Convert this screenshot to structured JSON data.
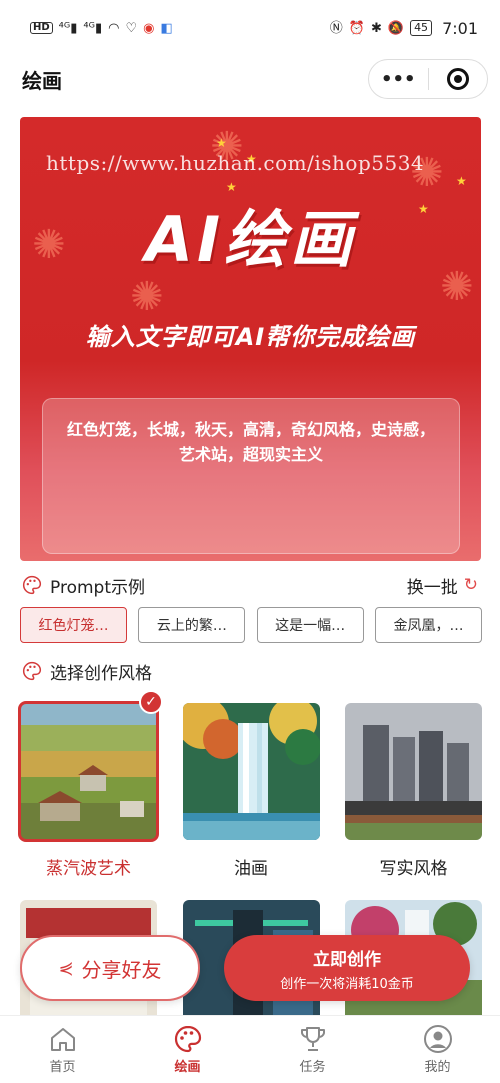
{
  "status_bar": {
    "left_icons": [
      "HD",
      "4G",
      "4G",
      "wifi",
      "heart",
      "weibo",
      "app"
    ],
    "battery": "45",
    "time": "7:01"
  },
  "nav": {
    "title": "绘画",
    "more_icon": "more-dots-icon",
    "close_icon": "target-icon"
  },
  "banner": {
    "watermark": "https://www.huzhan.com/ishop5534",
    "title": "AI绘画",
    "subtitle": "输入文字即可AI帮你完成绘画",
    "prompt_text": "红色灯笼，长城，秋天，高清，奇幻风格，史诗感，艺术站，超现实主义"
  },
  "prompt_section": {
    "title": "Prompt示例",
    "refresh_label": "换一批",
    "chips": [
      "红色灯笼…",
      "云上的繁…",
      "这是一幅…",
      "金凤凰，…"
    ],
    "active_chip": 0
  },
  "style_section": {
    "title": "选择创作风格",
    "styles": [
      {
        "label": "蒸汽波艺术",
        "selected": true
      },
      {
        "label": "油画",
        "selected": false
      },
      {
        "label": "写实风格",
        "selected": false
      }
    ]
  },
  "actions": {
    "share_label": "分享好友",
    "create_title": "立即创作",
    "create_sub": "创作一次将消耗10金币"
  },
  "tabs": [
    {
      "label": "首页",
      "icon": "home-icon",
      "active": false
    },
    {
      "label": "绘画",
      "icon": "palette-icon",
      "active": true
    },
    {
      "label": "任务",
      "icon": "trophy-icon",
      "active": false
    },
    {
      "label": "我的",
      "icon": "user-icon",
      "active": false
    }
  ],
  "colors": {
    "accent": "#d23434",
    "banner_red": "#d42a2a"
  }
}
